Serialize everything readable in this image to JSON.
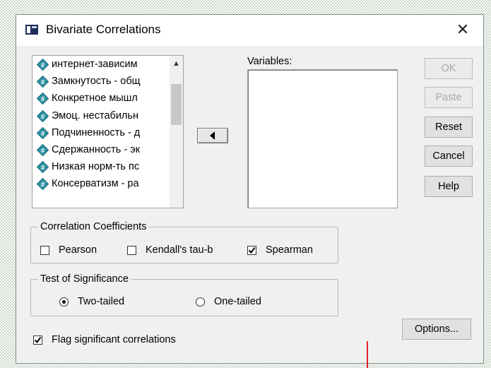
{
  "window": {
    "title": "Bivariate Correlations",
    "close_glyph": "✕"
  },
  "source_list": {
    "items": [
      {
        "label": "интернет-зависим"
      },
      {
        "label": "Замкнутость - общ"
      },
      {
        "label": "Конкретное мышл"
      },
      {
        "label": "Эмоц. нестабильн"
      },
      {
        "label": "Подчиненность - д"
      },
      {
        "label": "Сдержанность - эк"
      },
      {
        "label": "Низкая норм-ть пс"
      },
      {
        "label": "Консерватизм - ра"
      }
    ],
    "icon": "scale-variable-icon",
    "scroll_up_glyph": "▲"
  },
  "move_button": {
    "icon": "left-arrow-icon"
  },
  "variables": {
    "label": "Variables:",
    "items": []
  },
  "buttons": {
    "ok": "OK",
    "paste": "Paste",
    "reset": "Reset",
    "cancel": "Cancel",
    "help": "Help",
    "options": "Options..."
  },
  "correlation_coefficients": {
    "title": "Correlation Coefficients",
    "pearson": {
      "label": "Pearson",
      "checked": false
    },
    "kendall": {
      "label": "Kendall's tau-b",
      "checked": false
    },
    "spearman": {
      "label": "Spearman",
      "checked": true
    }
  },
  "significance": {
    "title": "Test of Significance",
    "two_tailed": {
      "label": "Two-tailed",
      "selected": true
    },
    "one_tailed": {
      "label": "One-tailed",
      "selected": false
    }
  },
  "flag_significant": {
    "label": "Flag significant correlations",
    "checked": true
  },
  "colors": {
    "dialog_bg": "#f0f0f0",
    "icon_teal": "#2a8fa0",
    "accent_red": "#e0202a",
    "disabled_text": "#a8a8a8"
  }
}
